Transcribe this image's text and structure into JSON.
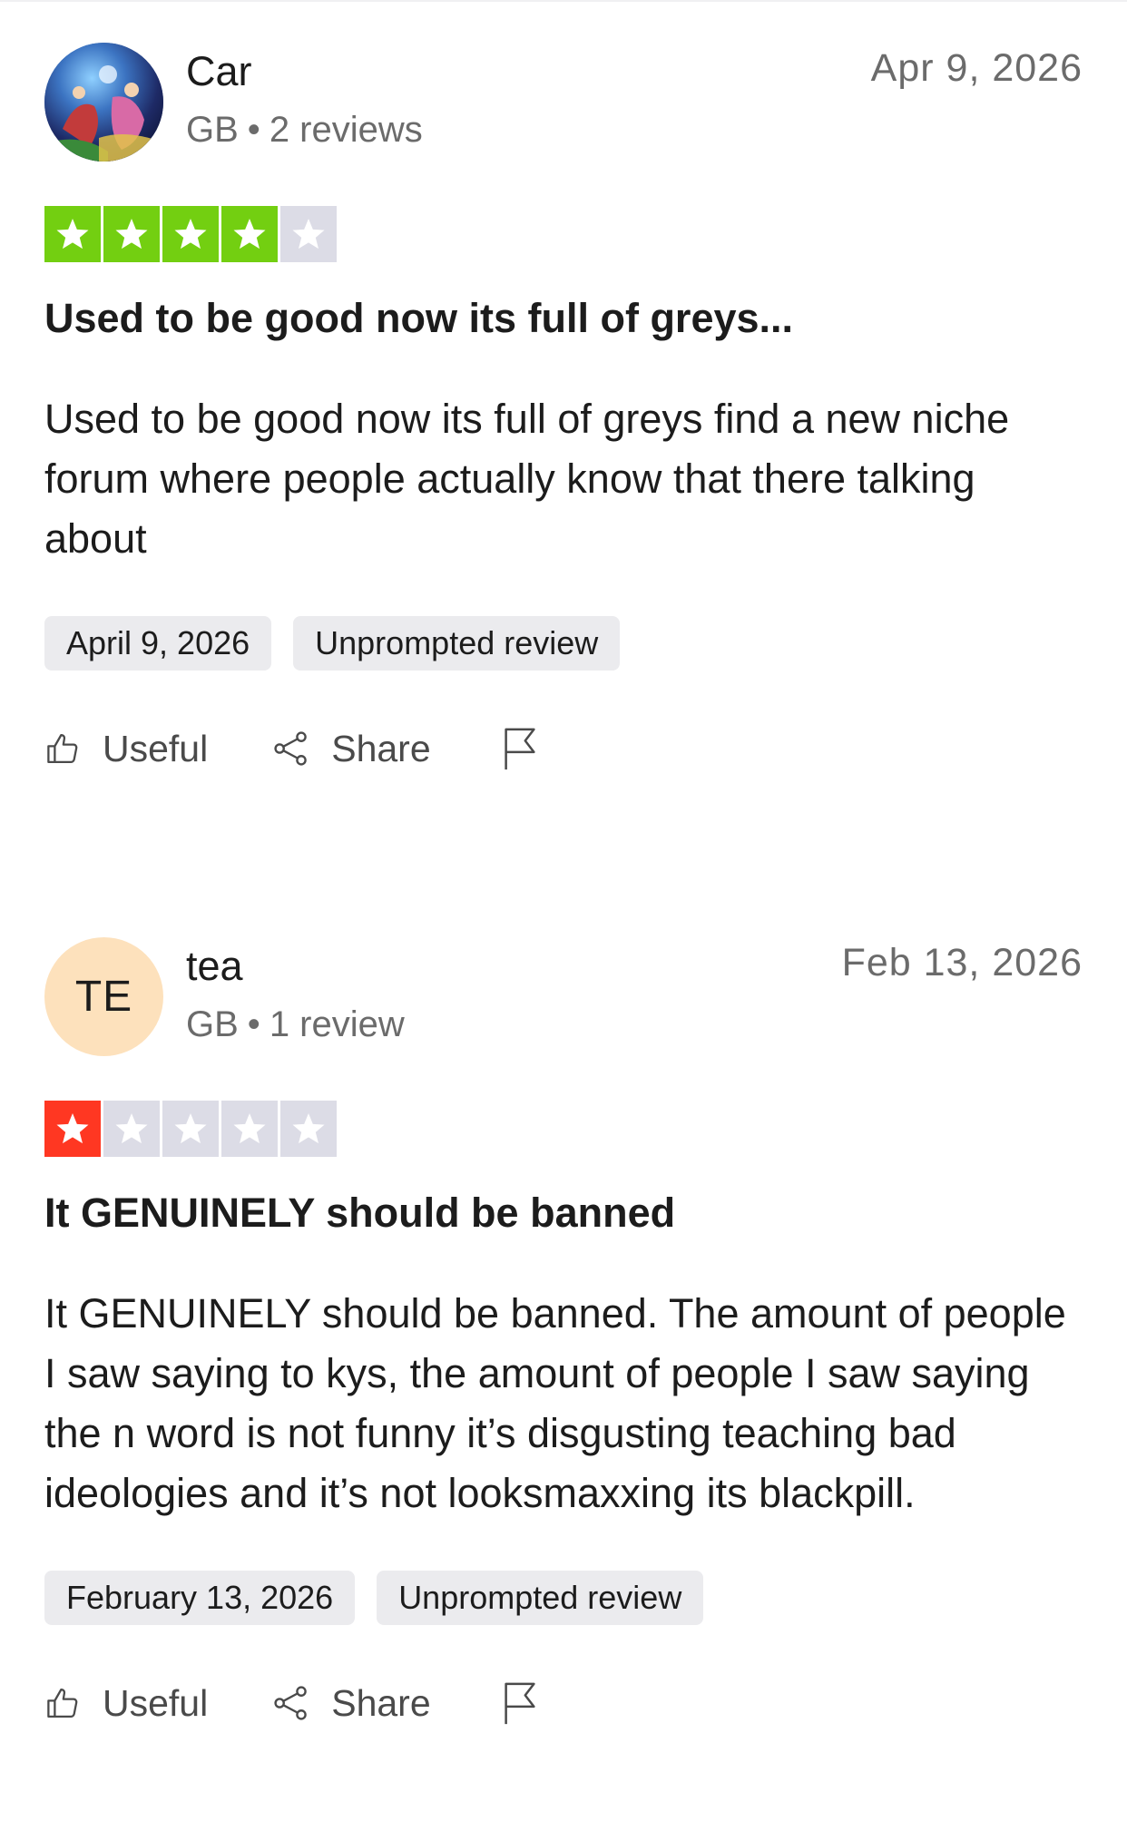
{
  "reviews": [
    {
      "author": "Car",
      "country": "GB",
      "review_count": "2 reviews",
      "date": "Apr 9, 2026",
      "rating": 4,
      "rating_max": 5,
      "star_color": "#73cf11",
      "title": "Used to be good now its full of greys...",
      "body": "Used to be good now its full of greys find a new niche forum where people actually know that there talking about",
      "date_tag": "April 9, 2026",
      "source_tag": "Unprompted review",
      "useful_label": "Useful",
      "share_label": "Share"
    },
    {
      "author": "tea",
      "avatar_initials": "TE",
      "country": "GB",
      "review_count": "1 review",
      "date": "Feb 13, 2026",
      "rating": 1,
      "rating_max": 5,
      "star_color": "#ff3722",
      "title": "It GENUINELY should be banned",
      "body": "It GENUINELY should be banned. The amount of people I saw saying to kys, the amount of people I saw saying the n word is not funny it’s disgusting teaching bad ideologies and it’s not looksmaxxing its blackpill.",
      "date_tag": "February 13, 2026",
      "source_tag": "Unprompted review",
      "useful_label": "Useful",
      "share_label": "Share"
    }
  ],
  "colors": {
    "empty_star": "#dcdce6",
    "tag_bg": "#ebebee",
    "avatar_initials_bg": "#fde1bc"
  },
  "icons": [
    "thumbs-up-icon",
    "share-icon",
    "flag-icon",
    "star-icon"
  ]
}
